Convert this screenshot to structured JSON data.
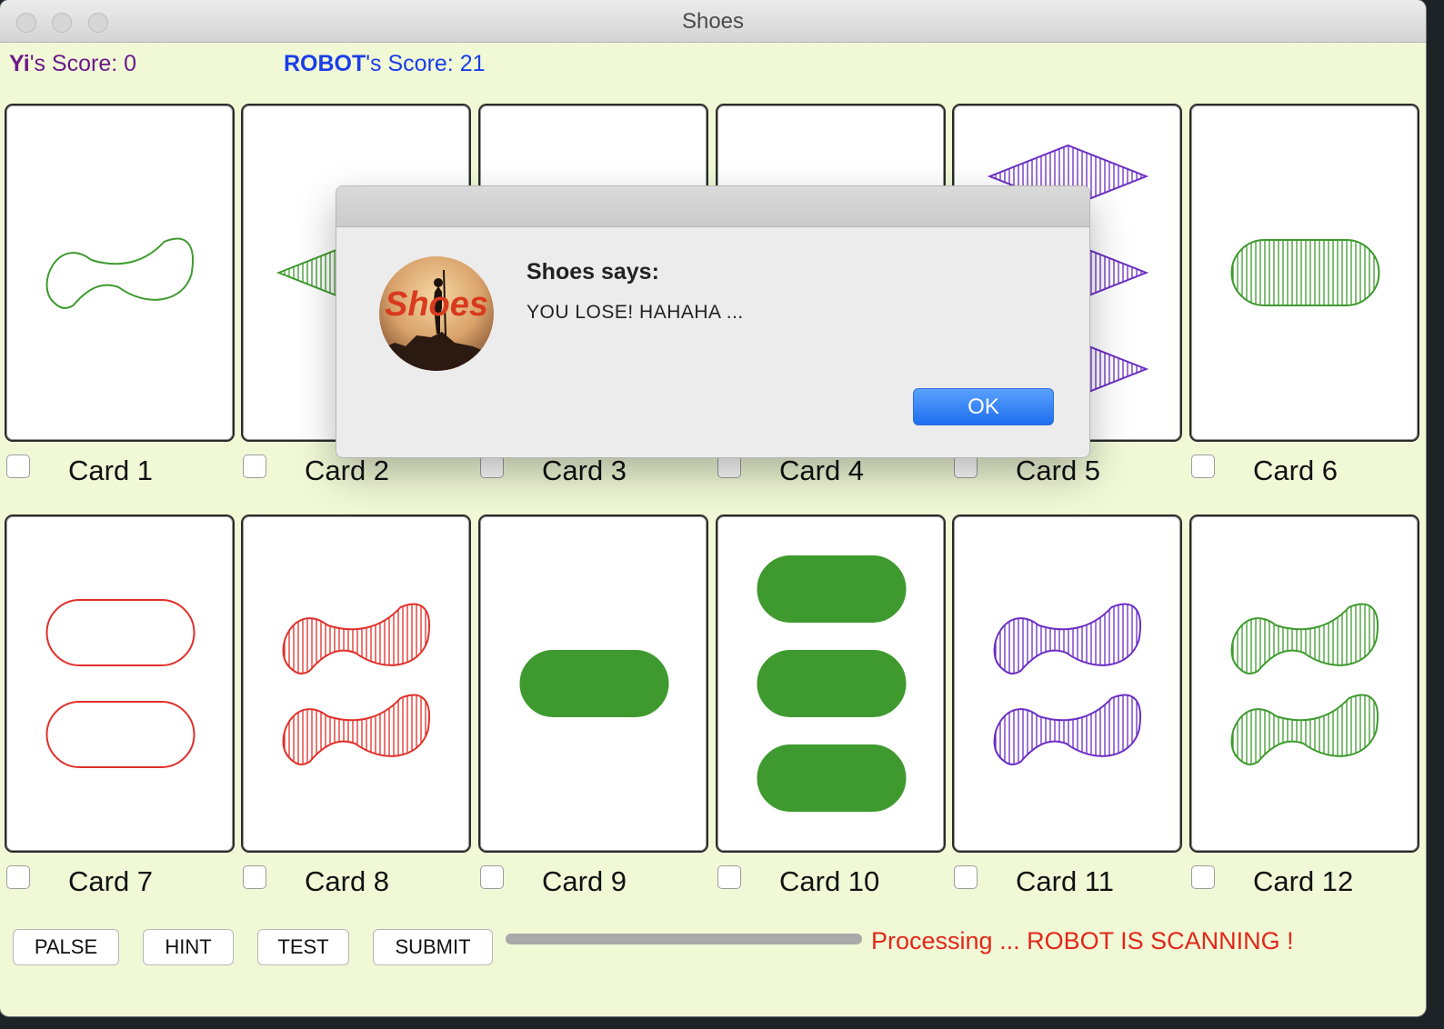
{
  "window": {
    "title": "Shoes"
  },
  "scores": {
    "player_name": "Yi",
    "player_suffix": "'s Score: 0",
    "player_color": "#6a1a8a",
    "robot_name": "ROBOT",
    "robot_suffix": "'s Score: 21",
    "robot_color": "#1a3ee8"
  },
  "shape_colors": {
    "green": "#3e9a2e",
    "red": "#e0302a",
    "purple": "#6b2ec4"
  },
  "cards": [
    {
      "label": "Card 1",
      "count": 1,
      "shape": "squiggle",
      "color": "green",
      "fill": "outline"
    },
    {
      "label": "Card 2",
      "count": 1,
      "shape": "diamond",
      "color": "green",
      "fill": "striped"
    },
    {
      "label": "Card 3",
      "count": 0,
      "shape": "none",
      "color": "green",
      "fill": "outline"
    },
    {
      "label": "Card 4",
      "count": 0,
      "shape": "none",
      "color": "green",
      "fill": "outline"
    },
    {
      "label": "Card 5",
      "count": 3,
      "shape": "diamond",
      "color": "purple",
      "fill": "striped"
    },
    {
      "label": "Card 6",
      "count": 1,
      "shape": "oval",
      "color": "green",
      "fill": "striped"
    },
    {
      "label": "Card 7",
      "count": 2,
      "shape": "oval",
      "color": "red",
      "fill": "outline"
    },
    {
      "label": "Card 8",
      "count": 2,
      "shape": "squiggle",
      "color": "red",
      "fill": "striped"
    },
    {
      "label": "Card 9",
      "count": 1,
      "shape": "oval",
      "color": "green",
      "fill": "solid"
    },
    {
      "label": "Card 10",
      "count": 3,
      "shape": "oval",
      "color": "green",
      "fill": "solid"
    },
    {
      "label": "Card 11",
      "count": 2,
      "shape": "squiggle",
      "color": "purple",
      "fill": "striped"
    },
    {
      "label": "Card 12",
      "count": 2,
      "shape": "squiggle",
      "color": "green",
      "fill": "striped"
    }
  ],
  "buttons": {
    "palse": "PALSE",
    "hint": "HINT",
    "test": "TEST",
    "submit": "SUBMIT"
  },
  "progress": {
    "value": 1.0
  },
  "status": "Processing ... ROBOT IS SCANNING !",
  "dialog": {
    "logo_text": "Shoes",
    "title": "Shoes says:",
    "message": "YOU LOSE! HAHAHA ...",
    "ok_label": "OK"
  }
}
